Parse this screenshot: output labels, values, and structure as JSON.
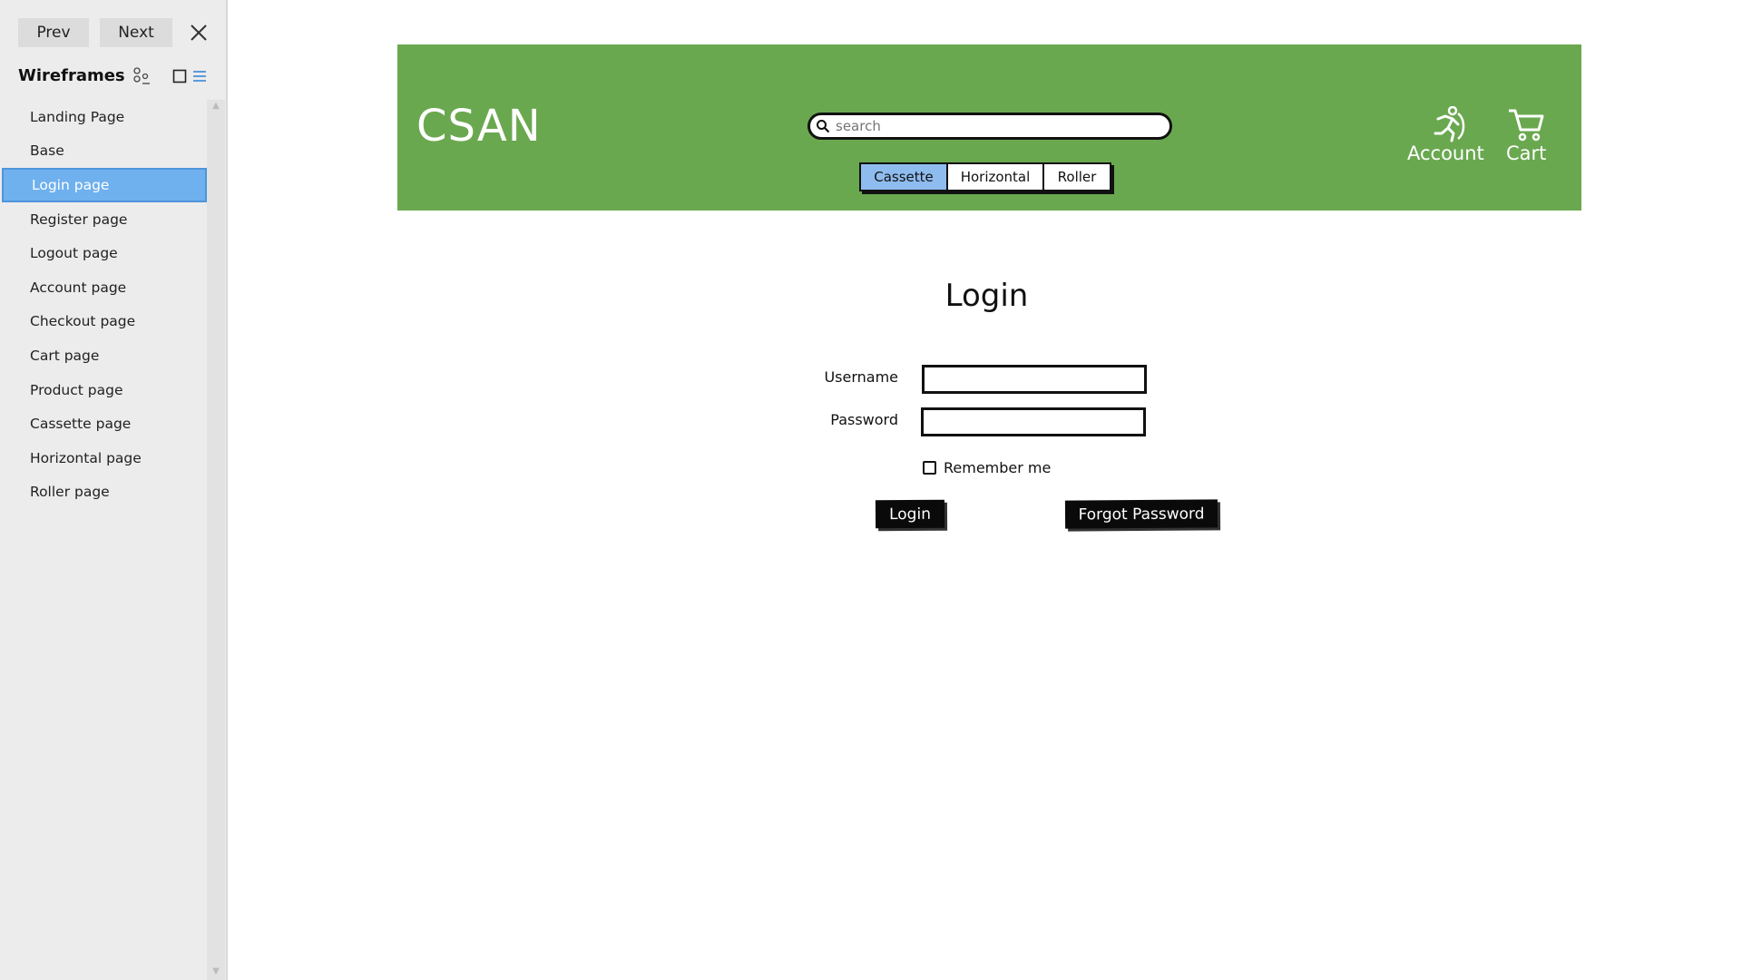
{
  "sidebar": {
    "prev_label": "Prev",
    "next_label": "Next",
    "title": "Wireframes",
    "pages": [
      {
        "label": "Landing Page",
        "selected": false
      },
      {
        "label": "Base",
        "selected": false
      },
      {
        "label": "Login page",
        "selected": true
      },
      {
        "label": "Register page",
        "selected": false
      },
      {
        "label": "Logout page",
        "selected": false
      },
      {
        "label": "Account page",
        "selected": false
      },
      {
        "label": "Checkout page",
        "selected": false
      },
      {
        "label": "Cart page",
        "selected": false
      },
      {
        "label": "Product page",
        "selected": false
      },
      {
        "label": "Cassette page",
        "selected": false
      },
      {
        "label": "Horizontal page",
        "selected": false
      },
      {
        "label": "Roller page",
        "selected": false
      }
    ],
    "selected_color": "#6fb0ee"
  },
  "header": {
    "brand": "CSAN",
    "search_placeholder": "search",
    "tabs": [
      {
        "label": "Cassette",
        "active": true
      },
      {
        "label": "Horizontal",
        "active": false
      },
      {
        "label": "Roller",
        "active": false
      }
    ],
    "account_label": "Account",
    "cart_label": "Cart",
    "background_color": "#6aa84f"
  },
  "login": {
    "title": "Login",
    "username_label": "Username",
    "password_label": "Password",
    "remember_label": "Remember me",
    "login_button": "Login",
    "forgot_button": "Forgot Password"
  }
}
